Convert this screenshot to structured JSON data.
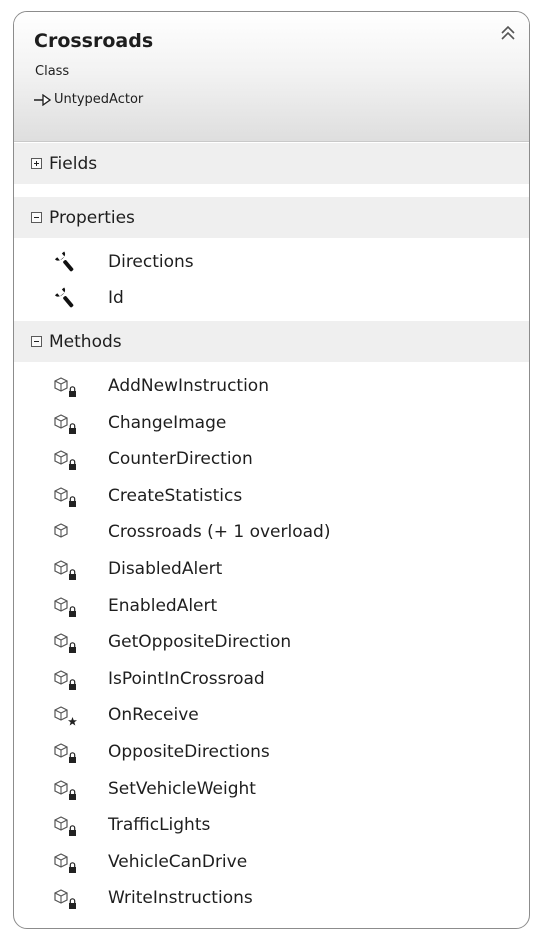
{
  "class": {
    "name": "Crossroads",
    "stereotype": "Class",
    "base_type": "UntypedActor"
  },
  "sections": {
    "fields": {
      "label": "Fields",
      "expanded": false
    },
    "properties": {
      "label": "Properties",
      "expanded": true
    },
    "methods": {
      "label": "Methods",
      "expanded": true
    }
  },
  "properties": [
    {
      "name": "Directions",
      "icon": "wrench-icon"
    },
    {
      "name": "Id",
      "icon": "wrench-icon"
    }
  ],
  "methods": [
    {
      "name": "AddNewInstruction",
      "access": "private"
    },
    {
      "name": "ChangeImage",
      "access": "private"
    },
    {
      "name": "CounterDirection",
      "access": "private"
    },
    {
      "name": "CreateStatistics",
      "access": "private"
    },
    {
      "name": "Crossroads (+ 1 overload)",
      "access": "public"
    },
    {
      "name": "DisabledAlert",
      "access": "private"
    },
    {
      "name": "EnabledAlert",
      "access": "private"
    },
    {
      "name": "GetOppositeDirection",
      "access": "private"
    },
    {
      "name": "IsPointInCrossroad",
      "access": "private"
    },
    {
      "name": "OnReceive",
      "access": "protected"
    },
    {
      "name": "OppositeDirections",
      "access": "private"
    },
    {
      "name": "SetVehicleWeight",
      "access": "private"
    },
    {
      "name": "TrafficLights",
      "access": "private"
    },
    {
      "name": "VehicleCanDrive",
      "access": "private"
    },
    {
      "name": "WriteInstructions",
      "access": "private"
    }
  ]
}
